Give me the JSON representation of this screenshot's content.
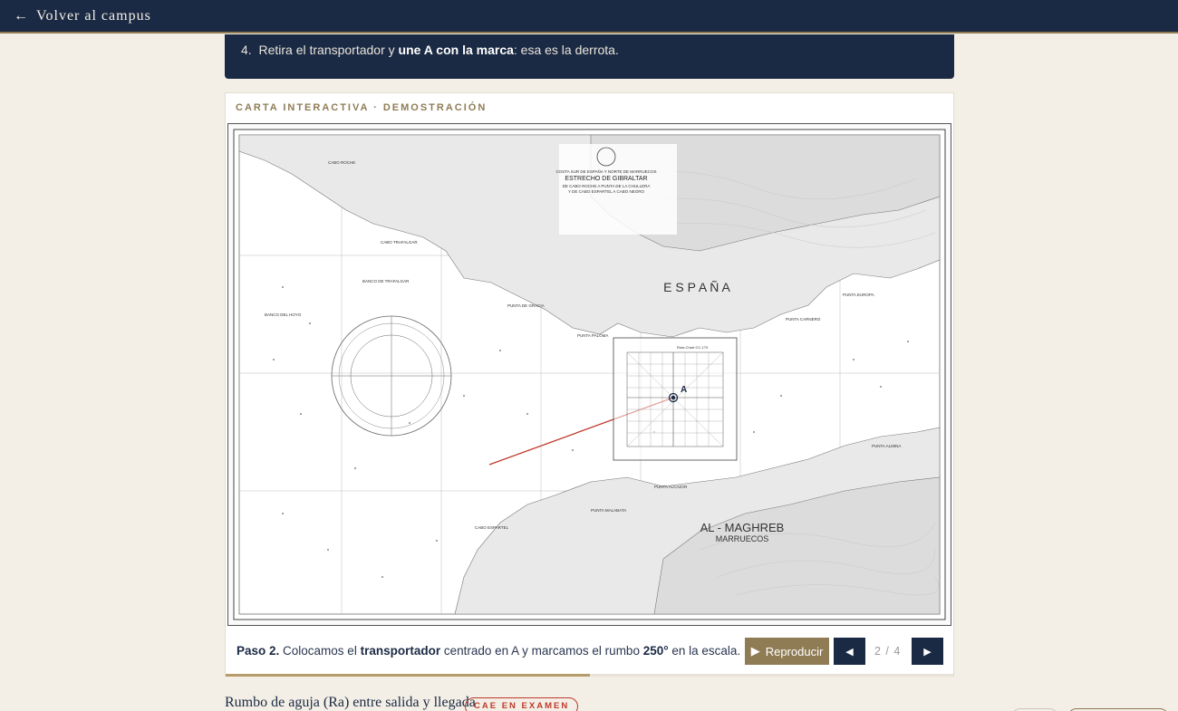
{
  "topbar": {
    "back_label": "Volver al campus",
    "back_icon": "arrow-left-icon"
  },
  "step_card": {
    "number": "4.",
    "text_before": "Retira el transportador y ",
    "text_bold": "une A con la marca",
    "text_after": ": esa es la derrota."
  },
  "demo": {
    "eyebrow": "CARTA INTERACTIVA · DEMOSTRACIÓN",
    "chart": {
      "title_lines": [
        "COSTA SUR DE ESPAÑA Y NORTE DE MARRUECOS",
        "ESTRECHO DE GIBRALTAR",
        "DE CABO ROCHE A PUNTA DE LA CHULLERA",
        "Y DE CABO ESPARTEL A CABO NEGRO"
      ],
      "country_north": "E S P A Ñ A",
      "country_south_1": "AL - MAGHREB",
      "country_south_2": "MARRUECOS",
      "point_label": "A",
      "protractor_label": "Ruta Chart CC-170",
      "place_names": [
        "CABO ROCHE",
        "CABO TRAFALGAR",
        "PUNTA DE GRACIA",
        "PUNTA PALOMA",
        "PUNTA CARNERO",
        "PUNTA EUROPA",
        "PUNTA ALMINA",
        "PUNTA ALCAZAR",
        "PUNTA MALABATA",
        "CABO ESPARTEL",
        "BANCO DEL HOYO",
        "BANCO DE TRAFALGAR"
      ],
      "course_degrees": 250
    },
    "caption": {
      "step_label": "Paso 2.",
      "t1": " Colocamos el ",
      "b1": "transportador",
      "t2": " centrado en A y marcamos el rumbo ",
      "b2": "250°",
      "t3": " en la escala."
    },
    "play_label": "Reproducir",
    "play_icon": "play-icon",
    "prev_icon": "previous-icon",
    "next_icon": "next-icon",
    "counter": "2 / 4",
    "progress": 0.5
  },
  "next_section": {
    "title": "Rumbo de aguja (Ra) entre salida y llegada",
    "badge": "CAE EN EXAMEN"
  },
  "colors": {
    "navy": "#1b2a44",
    "gold": "#8f7c55",
    "cream": "#f3efe6",
    "course_line": "#c0392b"
  }
}
